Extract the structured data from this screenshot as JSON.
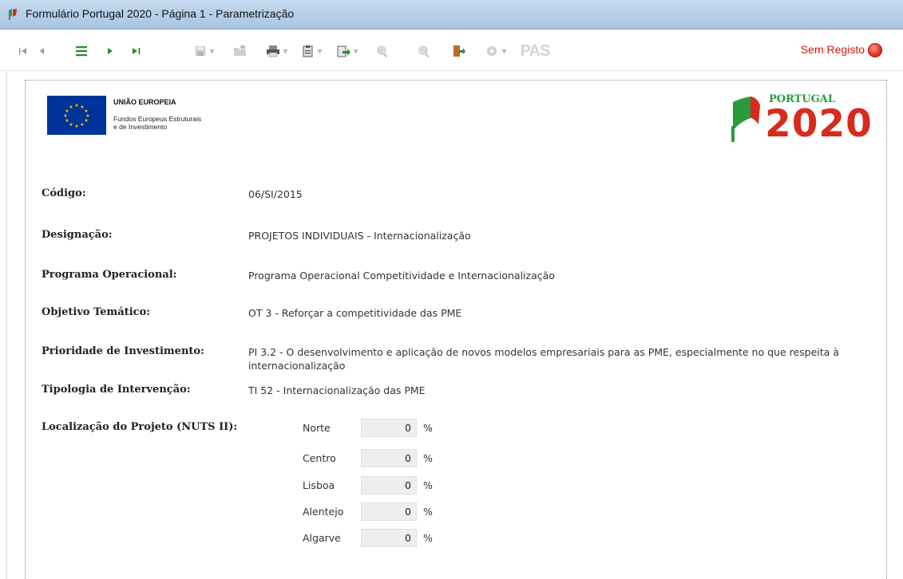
{
  "window": {
    "title": "Formulário Portugal 2020 - Página 1 - Parametrização",
    "icon": "portugal2020-flag-icon"
  },
  "toolbar": {
    "status_text": "Sem Registo",
    "status_color": "#e8321c",
    "pas_label": "PAS"
  },
  "header": {
    "eu_title": "UNIÃO EUROPEIA",
    "eu_sub1": "Fundos Europeus Estruturais",
    "eu_sub2": "e de Investimento",
    "pt_word": "PORTUGAL",
    "pt_year": "2020"
  },
  "fields": [
    {
      "label": "Código:",
      "value": "06/SI/2015"
    },
    {
      "label": "Designação:",
      "value": "PROJETOS INDIVIDUAIS - Internacionalização"
    },
    {
      "label": "Programa Operacional:",
      "value": "Programa Operacional Competitividade e Internacionalização"
    },
    {
      "label": "Objetivo Temático:",
      "value": "OT 3 - Reforçar a competitividade das PME"
    },
    {
      "label": "Prioridade de Investimento:",
      "value_line1": "PI 3.2 - O desenvolvimento e aplicação de novos modelos empresariais para as PME, especialmente no que respeita à",
      "value_line2": "internacionalização"
    },
    {
      "label": "Tipologia de Intervenção:",
      "value": "TI 52 - Internacionalização das PME"
    }
  ],
  "localizacao": {
    "label": "Localização do Projeto (NUTS II):",
    "regions": [
      {
        "name": "Norte",
        "value": "0",
        "unit": "%"
      },
      {
        "name": "Centro",
        "value": "0",
        "unit": "%"
      },
      {
        "name": "Lisboa",
        "value": "0",
        "unit": "%"
      },
      {
        "name": "Alentejo",
        "value": "0",
        "unit": "%"
      },
      {
        "name": "Algarve",
        "value": "0",
        "unit": "%"
      }
    ]
  },
  "colors": {
    "titlebar": "#b8cfe9",
    "pt_green": "#2a9b3a",
    "pt_red": "#d62b1e",
    "eu_blue": "#003399",
    "eu_star": "#ffcc00"
  }
}
